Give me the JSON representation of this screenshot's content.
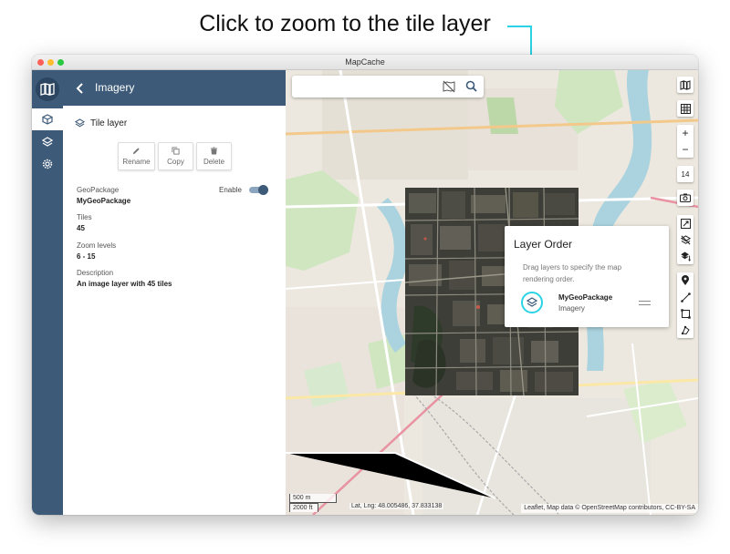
{
  "annotation": {
    "callout_text": "Click to zoom to the tile layer"
  },
  "window": {
    "title": "MapCache"
  },
  "panel": {
    "header_title": "Imagery",
    "layer_type_label": "Tile layer",
    "actions": [
      {
        "label": "Rename",
        "icon": "pencil-icon"
      },
      {
        "label": "Copy",
        "icon": "copy-icon"
      },
      {
        "label": "Delete",
        "icon": "trash-icon"
      }
    ],
    "enable_label": "Enable",
    "enabled": true,
    "fields": [
      {
        "key": "GeoPackage",
        "value": "MyGeoPackage"
      },
      {
        "key": "Tiles",
        "value": "45"
      },
      {
        "key": "Zoom levels",
        "value": "6 - 15"
      },
      {
        "key": "Description",
        "value": "An image layer with 45 tiles"
      }
    ]
  },
  "map": {
    "search": {
      "placeholder": ""
    },
    "zoom_level": "14",
    "layer_order": {
      "title": "Layer Order",
      "description": "Drag layers to specify the map rendering order.",
      "item_name": "MyGeoPackage",
      "item_type": "Imagery"
    },
    "scale_metric": "500 m",
    "scale_imperial": "2000 ft",
    "latlng": "Lat, Lng: 48.005486, 37.833138",
    "attribution": "Leaflet, Map data © OpenStreetMap contributors, CC-BY-SA"
  },
  "colors": {
    "primary": "#3d5a78",
    "accent": "#2ad4e6"
  }
}
